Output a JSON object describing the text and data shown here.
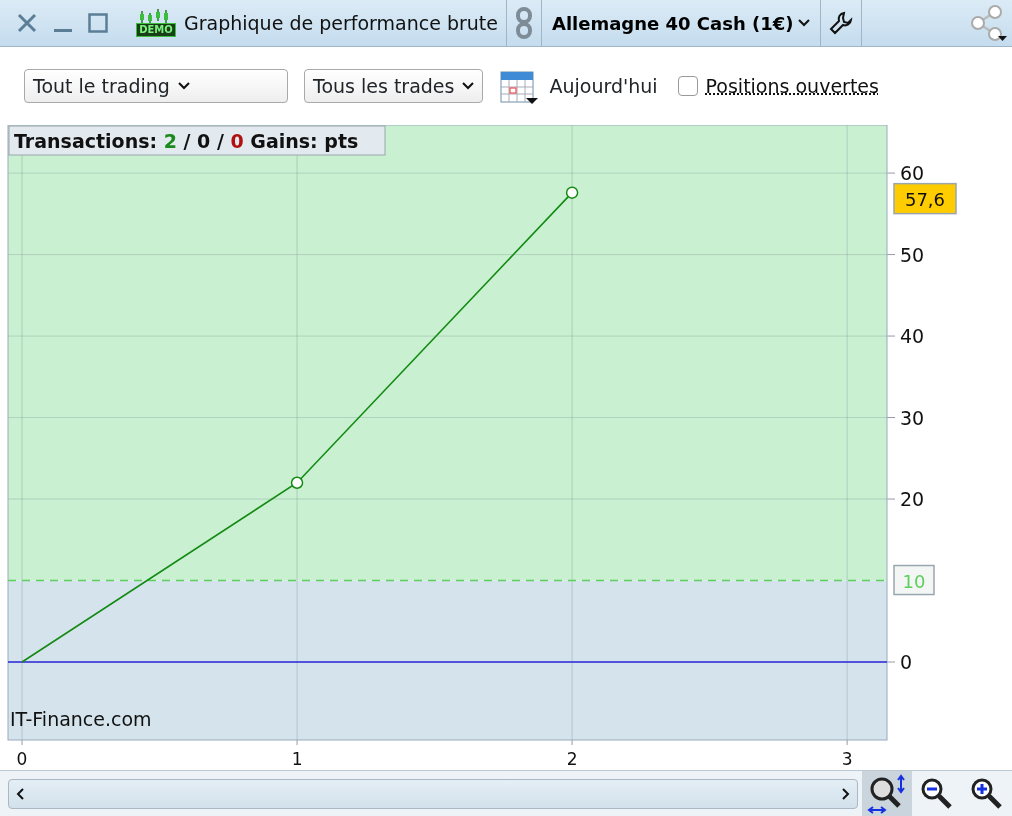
{
  "window": {
    "title": "Graphique de performance brute",
    "badge": "DEMO"
  },
  "instrument": {
    "label": "Allemagne 40 Cash (1€)"
  },
  "filters": [
    {
      "value": "Tout le trading"
    },
    {
      "value": "Tous les trades"
    }
  ],
  "date": {
    "label": "Aujourd'hui"
  },
  "open_positions": {
    "label": "Positions ouvertes",
    "checked": false
  },
  "stats": {
    "label": "Transactions:",
    "wins": "2",
    "separator_1": "/",
    "neutral": "0",
    "separator_2": "/",
    "losses": "0",
    "gains_label": "Gains: pts"
  },
  "chart": {
    "source": "IT-Finance.com",
    "chart_data": {
      "type": "line",
      "x": [
        0,
        1,
        2
      ],
      "series": [
        {
          "color": "#138a13",
          "values": [
            0,
            22,
            57.6
          ]
        }
      ],
      "xlim": [
        -0.051,
        3.145
      ],
      "ylim": [
        -9.57,
        65.9
      ],
      "xticks": [
        0,
        1,
        2,
        3
      ],
      "yticks": [
        0,
        20,
        30,
        40,
        50,
        60
      ],
      "grid": true,
      "ref_lines": [
        {
          "axis": "y",
          "value": 10,
          "label": "10",
          "color": "#5ccf5c"
        },
        {
          "axis": "y",
          "value": 0,
          "color": "#2424d6"
        }
      ],
      "bands": [
        {
          "axis": "y",
          "from": 10,
          "to": 65.9,
          "color": "#c9f0d0"
        },
        {
          "axis": "y",
          "from": -9.57,
          "to": 10,
          "color": "#d5e4ec"
        }
      ],
      "annotations": [
        "57,6"
      ]
    }
  }
}
